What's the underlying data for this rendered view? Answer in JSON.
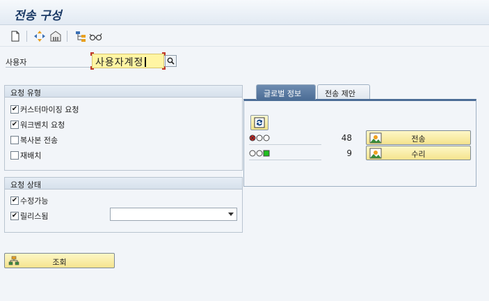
{
  "window": {
    "title": "전송 구성"
  },
  "toolbar": {
    "icons": [
      "new-document-icon",
      "transport-route-icon",
      "warehouse-icon",
      "hierarchy-icon",
      "glasses-icon"
    ]
  },
  "user": {
    "label": "사용자",
    "value": "사용자계정"
  },
  "request_type": {
    "title": "요청 유형",
    "options": [
      {
        "label": "커스터마이징 요청",
        "checked": true
      },
      {
        "label": "워크벤치 요청",
        "checked": true
      },
      {
        "label": "복사본 전송",
        "checked": false
      },
      {
        "label": "재배치",
        "checked": false
      }
    ]
  },
  "request_status": {
    "title": "요청 상태",
    "options": [
      {
        "label": "수정가능",
        "checked": true
      },
      {
        "label": "릴리스됨",
        "checked": true
      }
    ],
    "dropdown_value": ""
  },
  "tabs": [
    {
      "label": "글로벌 정보",
      "active": true
    },
    {
      "label": "전송 제안",
      "active": false
    }
  ],
  "status_rows": [
    {
      "lights": [
        "red",
        "off",
        "off"
      ],
      "count": "48",
      "button_label": "전송"
    },
    {
      "lights": [
        "off",
        "off",
        "green"
      ],
      "count": "9",
      "button_label": "수리"
    }
  ],
  "query_button": {
    "label": "조회"
  },
  "colors": {
    "active_tab": "#4c6d96",
    "button_yellow": "#f5e48e",
    "input_yellow": "#fff5a3",
    "title_blue": "#1b3a66"
  }
}
